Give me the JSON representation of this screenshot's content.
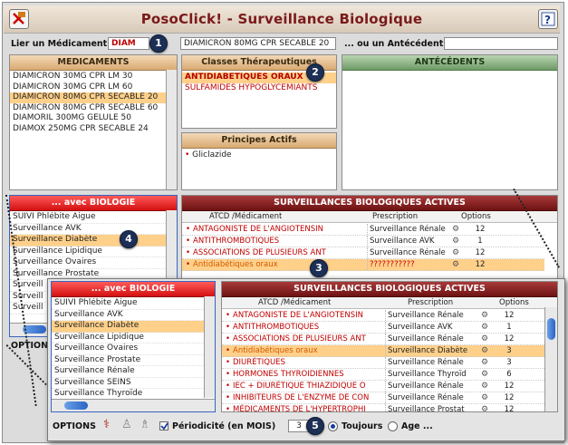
{
  "window": {
    "title": "PosoClick! - Surveillance Biologique"
  },
  "search": {
    "medicament_label": "Lier un Médicament:",
    "medicament_value": "DIAM",
    "selected_medicament": "DIAMICRON 80MG CPR SECABLE 20",
    "antecedent_label": "... ou un Antécédent:",
    "antecedent_value": ""
  },
  "medicaments": {
    "header": "MEDICAMENTS",
    "items": [
      "DIAMICRON 30MG CPR LM 30",
      "DIAMICRON 30MG CPR LM 60",
      "DIAMICRON 80MG CPR SECABLE 20",
      "DIAMICRON 80MG CPR SECABLE 60",
      "DIAMORIL 300MG GELULE 50",
      "DIAMOX 250MG CPR SECABLE 24"
    ],
    "selected_index": 2
  },
  "classes": {
    "header": "Classes Thérapeutiques",
    "items": [
      "ANTIDIABÉTIQUES ORAUX",
      "SULFAMIDES HYPOGLYCÉMIANTS"
    ]
  },
  "principes": {
    "header": "Principes Actifs",
    "items": [
      "Gliclazide"
    ]
  },
  "antecedents": {
    "header": "ANTÉCÉDENTS"
  },
  "biologie": {
    "header": "... avec BIOLOGIE",
    "items_back": [
      "SUIVI Phlébite Aigue",
      "Surveillance AVK",
      "Surveillance Diabète",
      "Surveillance Lipidique",
      "Surveillance Ovaires",
      "Surveillance Prostate",
      "Surveill",
      "Surveill",
      "Surveill"
    ],
    "items_front": [
      "SUIVI Phlébite Aigue",
      "Surveillance AVK",
      "Surveillance Diabète",
      "Surveillance Lipidique",
      "Surveillance Ovaires",
      "Surveillance Prostate",
      "Surveillance Rénale",
      "Surveillance SEINS",
      "Surveillance Thyroïde"
    ],
    "selected_index": 2
  },
  "surveillances": {
    "header": "SURVEILLANCES BIOLOGIQUES ACTIVES",
    "col_atcd": "ATCD /Médicament",
    "col_prescription": "Prescription",
    "col_options": "Options",
    "rows_back": [
      {
        "atcd": "ANTAGONISTE DE L'ANGIOTENSIN",
        "presc": "Surveillance Rénale",
        "val": "12"
      },
      {
        "atcd": "ANTITHROMBOTIQUES",
        "presc": "Surveillance AVK",
        "val": "1"
      },
      {
        "atcd": "ASSOCIATIONS DE PLUSIEURS ANT",
        "presc": "Surveillance Rénale",
        "val": "12"
      },
      {
        "atcd": "Antidiabétiques oraux",
        "presc": "???????????",
        "val": "12"
      }
    ],
    "rows_front": [
      {
        "atcd": "ANTAGONISTE DE L'ANGIOTENSIN",
        "presc": "Surveillance Rénale",
        "val": "12"
      },
      {
        "atcd": "ANTITHROMBOTIQUES",
        "presc": "Surveillance AVK",
        "val": "1"
      },
      {
        "atcd": "ASSOCIATIONS DE PLUSIEURS ANT",
        "presc": "Surveillance Rénale",
        "val": "12"
      },
      {
        "atcd": "Antidiabétiques oraux",
        "presc": "Surveillance Diabète",
        "val": "3"
      },
      {
        "atcd": "DIURÉTIQUES",
        "presc": "Surveillance Rénale",
        "val": "3"
      },
      {
        "atcd": "HORMONES THYROIDIENNES",
        "presc": "Surveillance Thyroïd",
        "val": "6"
      },
      {
        "atcd": "IEC + DIURÉTIQUE THIAZIDIQUE O",
        "presc": "Surveillance Rénale",
        "val": "12"
      },
      {
        "atcd": "INHIBITEURS DE L'ENZYME DE CON",
        "presc": "Surveillance Rénale",
        "val": "12"
      },
      {
        "atcd": "MÉDICAMENTS DE L'HYPERTROPHI",
        "presc": "Surveillance Prostat",
        "val": "12"
      }
    ],
    "selected_index": 3
  },
  "options": {
    "label": "OPTIONS",
    "label_back": "OPTION",
    "periodicite_label": "Périodicité (en MOIS)",
    "periodicite_checked": true,
    "periodicite_value": "3",
    "toujours_label": "Toujours",
    "age_label": "Age ..."
  },
  "badges": [
    "1",
    "2",
    "3",
    "4",
    "5"
  ],
  "colors": {
    "title_red": "#7a1a1a",
    "selection": "#ffd08a",
    "alert_red": "#c00000",
    "header_red": "#d31010",
    "badge_navy": "#1d2f55"
  }
}
